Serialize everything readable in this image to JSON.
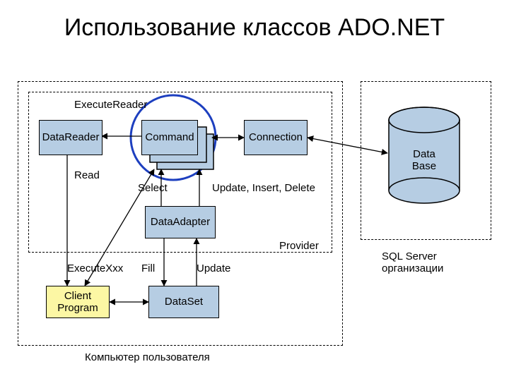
{
  "title": "Использование классов ADO.NET",
  "boxes": {
    "datareader": "DataReader",
    "command": "Command",
    "connection": "Connection",
    "dataadapter": "DataAdapter",
    "dataset": "DataSet",
    "client": "Client Program",
    "database": "Data Base"
  },
  "labels": {
    "execreader": "ExecuteReader",
    "read": "Read",
    "select": "Select",
    "uid": "Update, Insert, Delete",
    "provider": "Provider",
    "execxxx": "ExecuteXxx",
    "fill": "Fill",
    "update": "Update",
    "usercomputer": "Компьютер пользователя",
    "sqlserver": "SQL Server организации"
  }
}
